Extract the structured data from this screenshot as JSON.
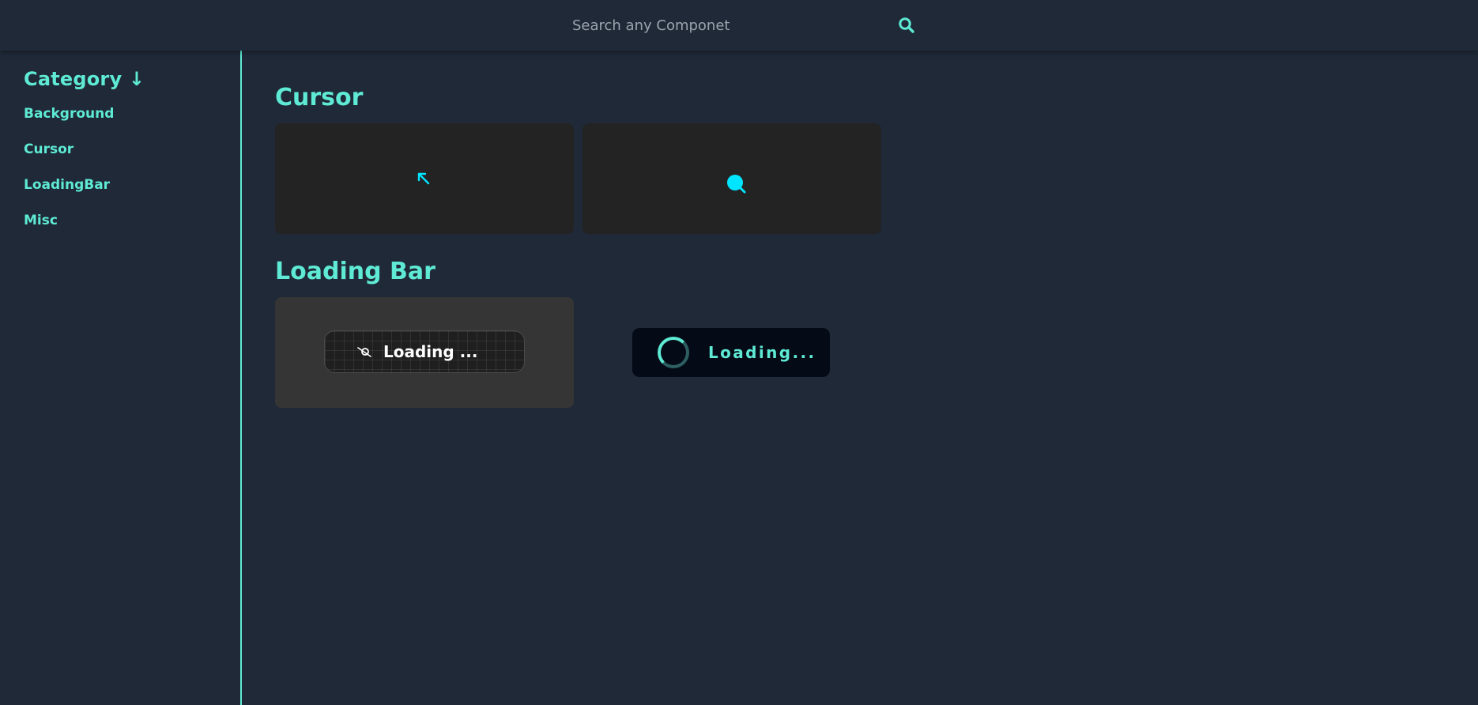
{
  "search": {
    "placeholder": "Search any Componet",
    "icon": "search-icon"
  },
  "sidebar": {
    "title": "Category ↓",
    "items": [
      {
        "label": "Background"
      },
      {
        "label": "Cursor"
      },
      {
        "label": "LoadingBar"
      },
      {
        "label": "Misc"
      }
    ]
  },
  "sections": [
    {
      "title": "Cursor",
      "cards": [
        {
          "icon": "arrow-cursor-icon"
        },
        {
          "icon": "magnifier-cursor-icon"
        }
      ]
    },
    {
      "title": "Loading Bar",
      "cards": [
        {
          "label": "Loading ...",
          "icon": "orbit-icon"
        },
        {
          "label": "Loading...",
          "icon": "spinner-icon"
        }
      ]
    }
  ],
  "colors": {
    "accent": "#5eead4",
    "background": "#1f2937",
    "card_dark": "#232323",
    "card_gray": "#353535",
    "cursor_cyan": "#00e5ff"
  }
}
